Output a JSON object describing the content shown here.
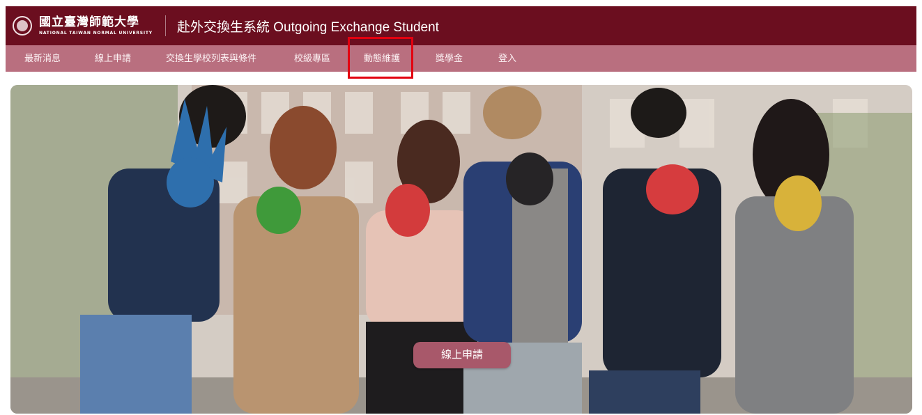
{
  "header": {
    "logo_cn": "國立臺灣師範大學",
    "logo_en": "NATIONAL TAIWAN NORMAL UNIVERSITY",
    "title": "赴外交換生系統 Outgoing Exchange Student"
  },
  "nav": {
    "items": [
      {
        "label": "最新消息"
      },
      {
        "label": "線上申請"
      },
      {
        "label": "交換生學校列表與條件"
      },
      {
        "label": "校級專區"
      },
      {
        "label": "動態維護"
      },
      {
        "label": "獎學金"
      },
      {
        "label": "登入"
      }
    ],
    "highlighted": "動態維護"
  },
  "hero": {
    "image": "students-raising-painted-hands-photo",
    "cta_label": "線上申請"
  },
  "colors": {
    "header_bg": "#6b0e1f",
    "nav_bg": "#b96f7f",
    "cta_bg": "#a8586a",
    "highlight": "#e3000f"
  }
}
